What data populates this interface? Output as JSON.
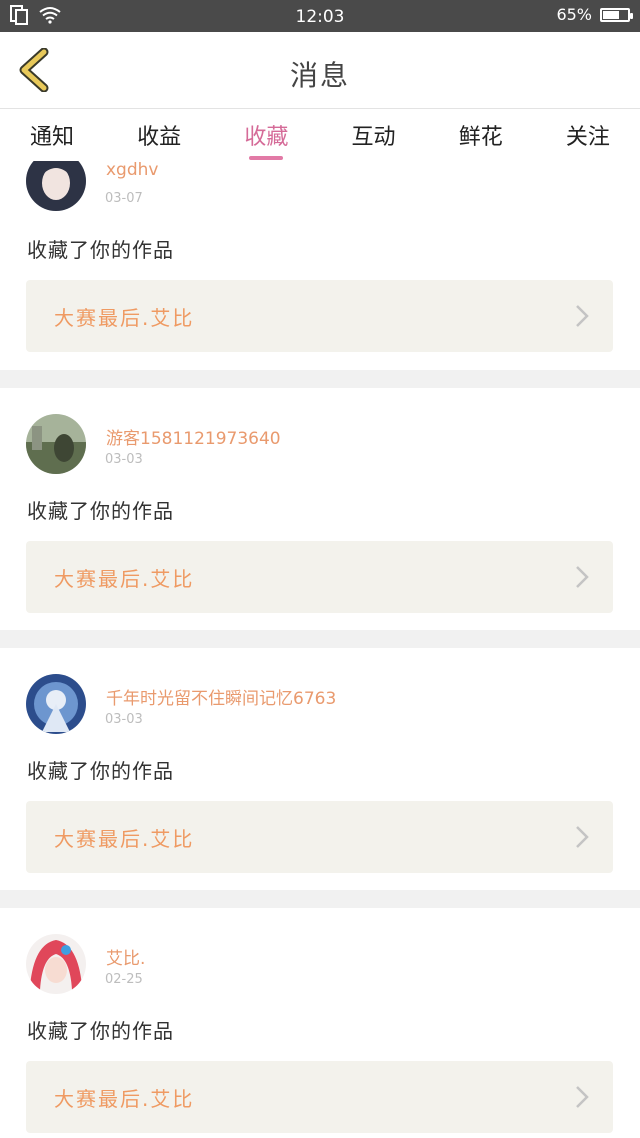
{
  "status_bar": {
    "time": "12:03",
    "battery_percent": "65%",
    "battery_level": 0.65
  },
  "header": {
    "title": "消息"
  },
  "tabs": [
    {
      "label": "通知"
    },
    {
      "label": "收益"
    },
    {
      "label": "收藏",
      "active": true
    },
    {
      "label": "互动"
    },
    {
      "label": "鲜花"
    },
    {
      "label": "关注"
    }
  ],
  "feed": {
    "items": [
      {
        "username": "xgdhv",
        "date": "03-07",
        "action": "收藏了你的作品",
        "work_title": "大赛最后.艾比"
      },
      {
        "username": "游客1581121973640",
        "date": "03-03",
        "action": "收藏了你的作品",
        "work_title": "大赛最后.艾比"
      },
      {
        "username": "千年时光留不住瞬间记忆6763",
        "date": "03-03",
        "action": "收藏了你的作品",
        "work_title": "大赛最后.艾比"
      },
      {
        "username": "艾比.",
        "date": "02-25",
        "action": "收藏了你的作品",
        "work_title": "大赛最后.艾比"
      }
    ]
  },
  "colors": {
    "accent_pink": "#e27aa6",
    "username_orange": "#e99a6e",
    "work_title_orange": "#ef9a62",
    "status_bar_bg": "#4a4a4a",
    "back_arrow": "#e8c95a"
  }
}
